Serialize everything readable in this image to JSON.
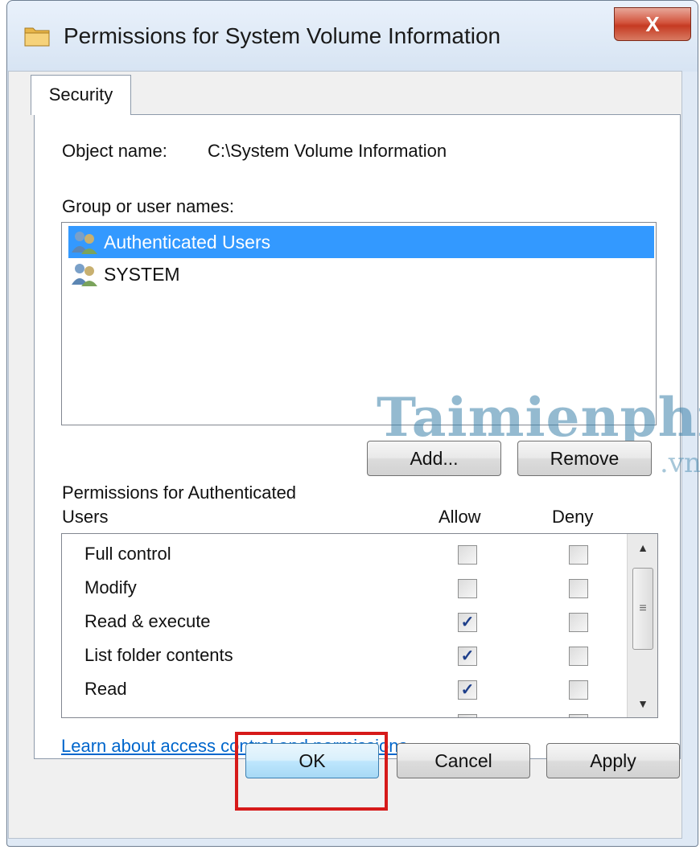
{
  "window": {
    "title": "Permissions for System Volume Information",
    "close_label": "X"
  },
  "tabs": [
    {
      "label": "Security",
      "active": true
    }
  ],
  "object": {
    "label": "Object name:",
    "value": "C:\\System Volume Information"
  },
  "group_label": "Group or user names:",
  "users": [
    {
      "name": "Authenticated Users",
      "selected": true,
      "icon": "users-group-icon"
    },
    {
      "name": "SYSTEM",
      "selected": false,
      "icon": "users-group-icon"
    }
  ],
  "buttons": {
    "add": "Add...",
    "remove": "Remove",
    "ok": "OK",
    "cancel": "Cancel",
    "apply": "Apply"
  },
  "permissions": {
    "header_line1": "Permissions for Authenticated",
    "header_line2": "Users",
    "allow_label": "Allow",
    "deny_label": "Deny",
    "rows": [
      {
        "name": "Full control",
        "allow": false,
        "deny": false
      },
      {
        "name": "Modify",
        "allow": false,
        "deny": false
      },
      {
        "name": "Read & execute",
        "allow": true,
        "deny": false
      },
      {
        "name": "List folder contents",
        "allow": true,
        "deny": false
      },
      {
        "name": "Read",
        "allow": true,
        "deny": false
      }
    ]
  },
  "link": "Learn about access control and permissions",
  "watermark": {
    "text": "Taimienphi",
    "sub": ".vn"
  },
  "colors": {
    "selection": "#3399ff",
    "highlight_box": "#d61a1a",
    "link": "#0066cc"
  }
}
